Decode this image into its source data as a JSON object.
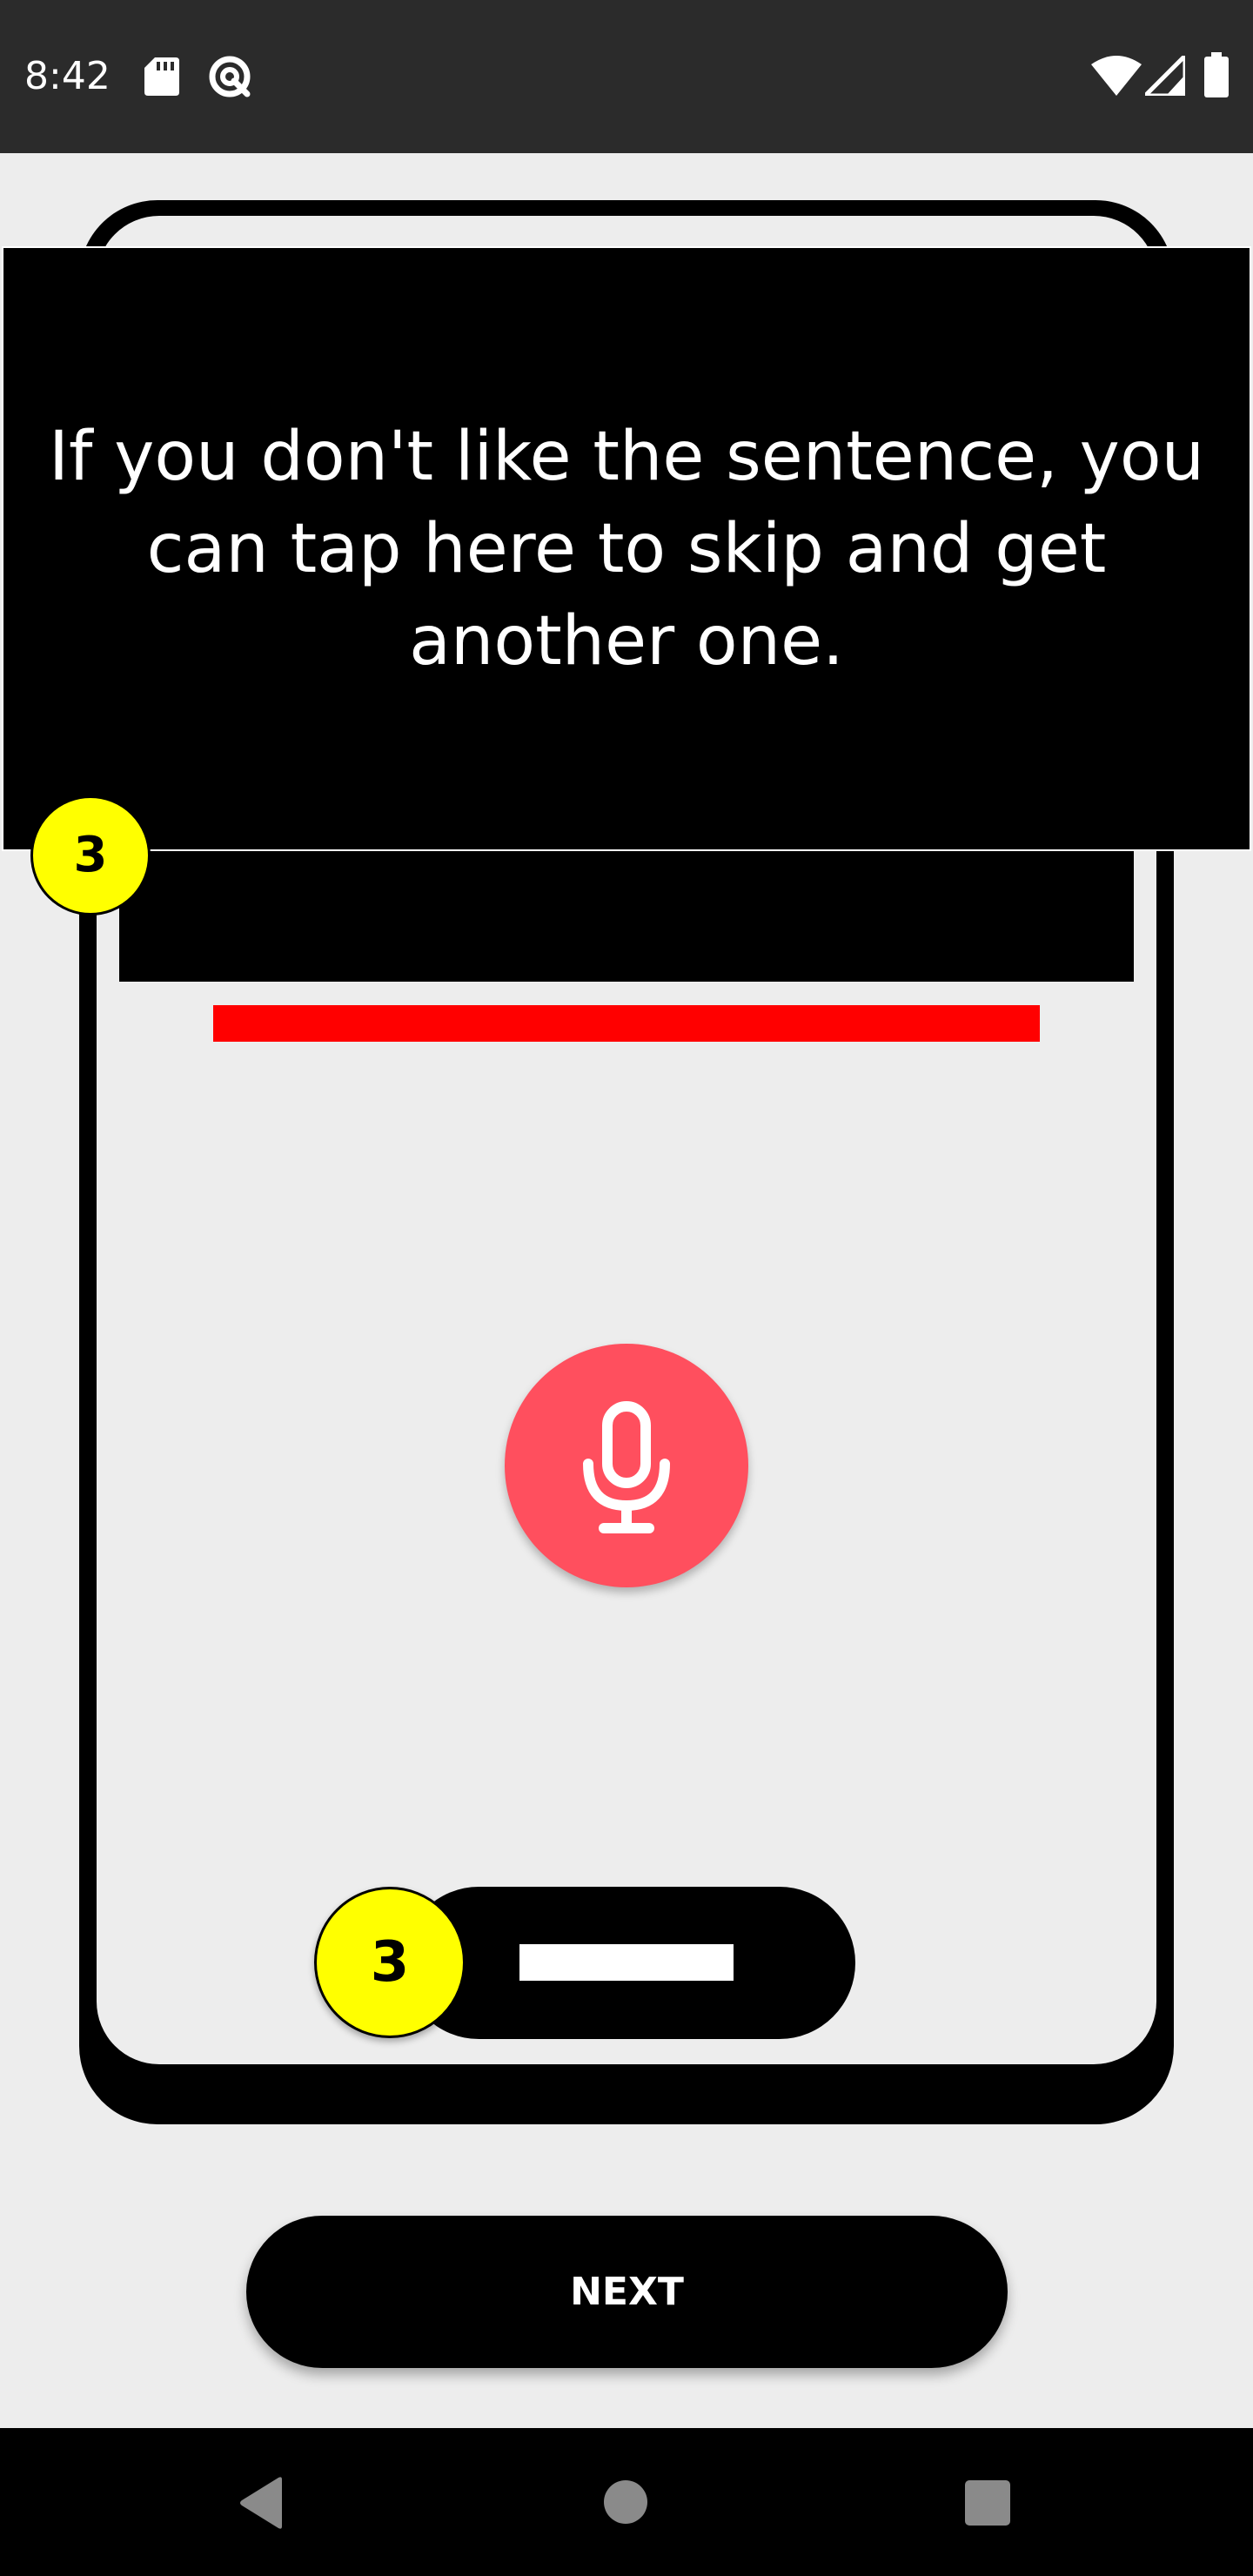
{
  "status_bar": {
    "time": "8:42",
    "icons": [
      "sd-card-icon",
      "data-saver-icon",
      "wifi-icon",
      "cellular-signal-icon",
      "battery-icon"
    ]
  },
  "tooltip": {
    "text": "If you don't like the sentence, you can tap here to skip and get another one."
  },
  "badges": {
    "top": "3",
    "bottom": "3"
  },
  "mic_button": {
    "icon": "microphone-icon",
    "color": "#ff4f5e"
  },
  "next_button": {
    "label": "NEXT"
  },
  "colors": {
    "background": "#ededed",
    "badge": "#ffff00",
    "progress_bar": "#ff0000",
    "mic": "#ff4f5e"
  },
  "nav_bar": {
    "icons": [
      "back-icon",
      "home-icon",
      "recents-icon"
    ]
  }
}
